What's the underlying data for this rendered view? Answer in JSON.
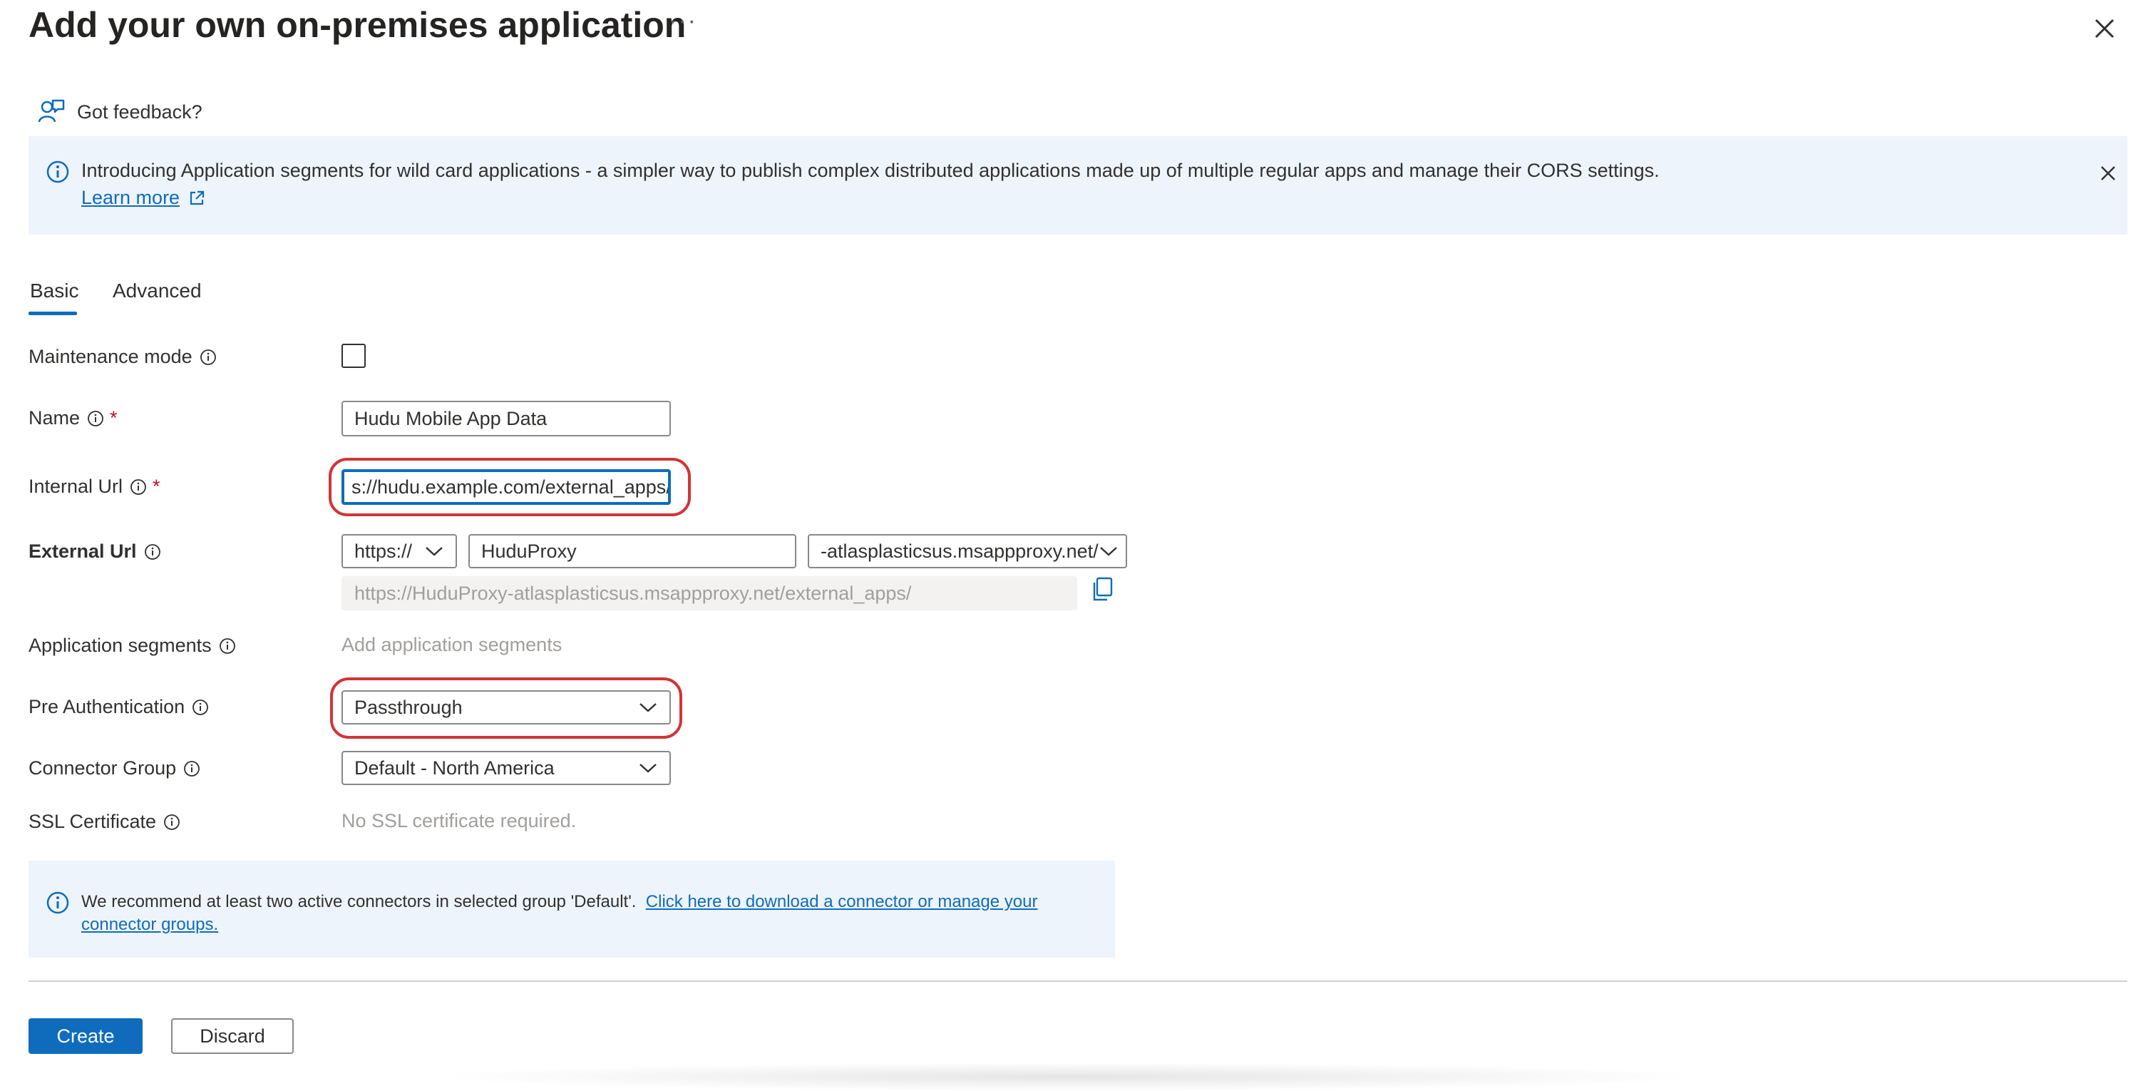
{
  "header": {
    "title": "Add your own on-premises application",
    "more_label": "···"
  },
  "feedback": {
    "label": "Got feedback?"
  },
  "banner": {
    "text": "Introducing Application segments for wild card applications - a simpler way to publish complex distributed applications made up of multiple regular apps and manage their CORS settings.",
    "link_label": "Learn more"
  },
  "tabs": [
    {
      "label": "Basic",
      "selected": true
    },
    {
      "label": "Advanced",
      "selected": false
    }
  ],
  "form": {
    "maintenance_mode": {
      "label": "Maintenance mode",
      "checked": false
    },
    "name": {
      "label": "Name",
      "required_mark": "*",
      "value": "Hudu Mobile App Data"
    },
    "internal_url": {
      "label": "Internal Url",
      "required_mark": "*",
      "value": "s://hudu.example.com/external_apps/"
    },
    "external_url": {
      "label": "External Url",
      "scheme": "https://",
      "prefix": "HuduProxy",
      "domain": "-atlasplasticsus.msappproxy.net/",
      "full_url": "https://HuduProxy-atlasplasticsus.msappproxy.net/external_apps/"
    },
    "app_segments": {
      "label": "Application segments",
      "link_label": "Add application segments"
    },
    "pre_auth": {
      "label": "Pre Authentication",
      "value": "Passthrough"
    },
    "connector_group": {
      "label": "Connector Group",
      "value": "Default - North America"
    },
    "ssl": {
      "label": "SSL Certificate",
      "value": "No SSL certificate required."
    }
  },
  "notice": {
    "text": "We recommend at least two active connectors in selected group 'Default'.",
    "link_label": "Click here to download a connector or manage your connector groups."
  },
  "footer": {
    "create_label": "Create",
    "discard_label": "Discard"
  },
  "colors": {
    "accent": "#0f6cbd",
    "banner_bg": "#eef4fc",
    "highlight_ring": "#d13438",
    "required": "#c50f1f"
  }
}
